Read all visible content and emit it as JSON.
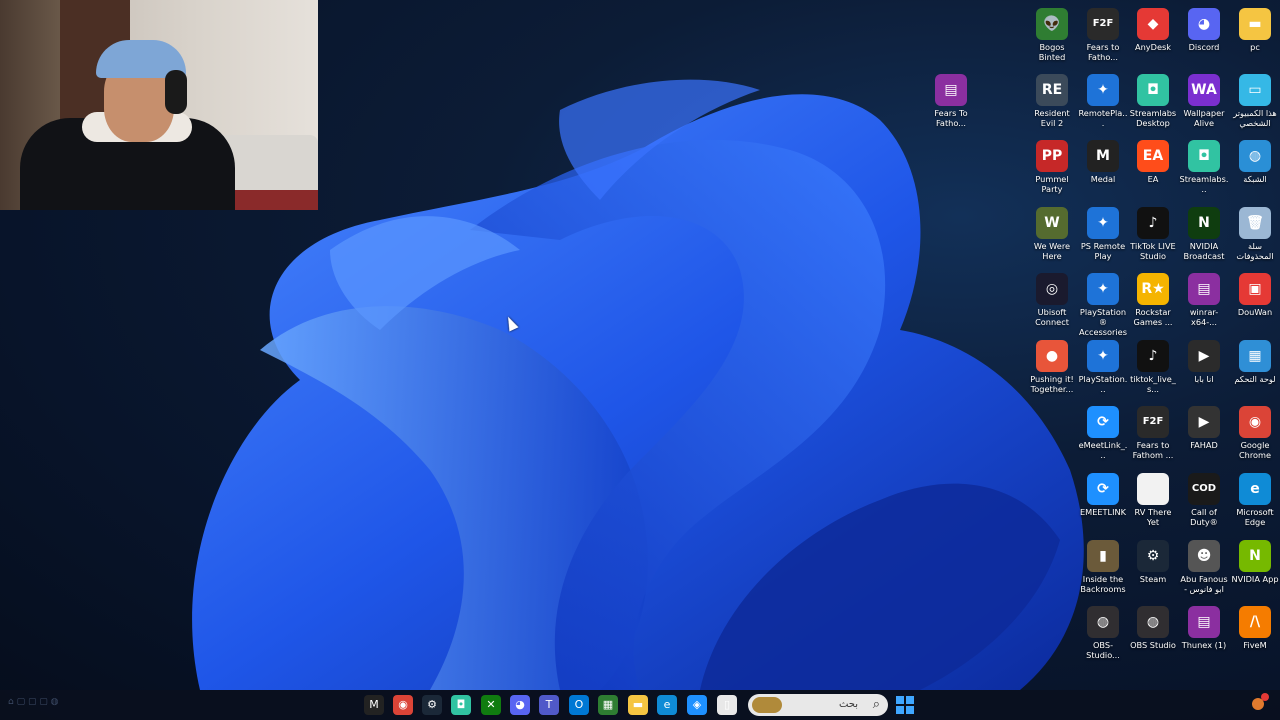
{
  "desktop": {
    "icons": [
      {
        "label": "Bogos Binted",
        "icon": "alien-icon",
        "color": "#2f7d32",
        "glyph": "👽"
      },
      {
        "label": "Fears to Fatho...",
        "icon": "f2f-icon",
        "color": "#2a2a2a",
        "glyph": "F2F"
      },
      {
        "label": "AnyDesk",
        "icon": "anydesk-icon",
        "color": "#e53935",
        "glyph": "◆"
      },
      {
        "label": "Discord",
        "icon": "discord-icon",
        "color": "#5865f2",
        "glyph": "◕"
      },
      {
        "label": "pc",
        "icon": "folder-icon",
        "color": "#f5c542",
        "glyph": "▬"
      },
      {
        "label": "Resident Evil 2",
        "icon": "resident-evil-icon",
        "color": "#3b4a5a",
        "glyph": "RE"
      },
      {
        "label": "RemotePla...",
        "icon": "remote-play-icon",
        "color": "#1e73d8",
        "glyph": "✦"
      },
      {
        "label": "Streamlabs Desktop",
        "icon": "streamlabs-icon",
        "color": "#31c3a2",
        "glyph": "◘"
      },
      {
        "label": "Wallpaper Alive",
        "icon": "wallpaper-alive-icon",
        "color": "#7b2fd0",
        "glyph": "WA"
      },
      {
        "label": "هذا الكمبيوتر الشخصي",
        "icon": "this-pc-icon",
        "color": "#35b8e6",
        "glyph": "▭"
      },
      {
        "label": "Pummel Party",
        "icon": "pummel-party-icon",
        "color": "#c62828",
        "glyph": "PP"
      },
      {
        "label": "Medal",
        "icon": "medal-icon",
        "color": "#222222",
        "glyph": "M"
      },
      {
        "label": "EA",
        "icon": "ea-icon",
        "color": "#ff4d1a",
        "glyph": "EA"
      },
      {
        "label": "Streamlabs...",
        "icon": "streamlabs-icon-2",
        "color": "#31c3a2",
        "glyph": "◘"
      },
      {
        "label": "الشبكة",
        "icon": "network-icon",
        "color": "#2a8fd6",
        "glyph": "◍"
      },
      {
        "label": "We Were Here",
        "icon": "we-were-here-icon",
        "color": "#556b2f",
        "glyph": "W"
      },
      {
        "label": "PS Remote Play",
        "icon": "ps-remote-play-icon",
        "color": "#1e73d8",
        "glyph": "✦"
      },
      {
        "label": "TikTok LIVE Studio",
        "icon": "tiktok-live-icon",
        "color": "#111",
        "glyph": "♪"
      },
      {
        "label": "NVIDIA Broadcast",
        "icon": "nvidia-broadcast-icon",
        "color": "#0f3d0f",
        "glyph": "N"
      },
      {
        "label": "سلة المحذوفات",
        "icon": "recycle-bin-icon",
        "color": "#9bb7d4",
        "glyph": "🗑"
      },
      {
        "label": "Ubisoft Connect",
        "icon": "ubisoft-icon",
        "color": "#1a1a2e",
        "glyph": "◎"
      },
      {
        "label": "PlayStation® Accessories",
        "icon": "ps-accessories-icon",
        "color": "#1e73d8",
        "glyph": "✦"
      },
      {
        "label": "Rockstar Games ...",
        "icon": "rockstar-icon",
        "color": "#f5b400",
        "glyph": "R★"
      },
      {
        "label": "winrar-x64-...",
        "icon": "winrar-icon",
        "color": "#8b2fa0",
        "glyph": "▤"
      },
      {
        "label": "DouWan",
        "icon": "douwan-icon",
        "color": "#e53935",
        "glyph": "▣"
      },
      {
        "label": "Pushing it! Together...",
        "icon": "pushing-it-icon",
        "color": "#e8553a",
        "glyph": "●"
      },
      {
        "label": "PlayStation...",
        "icon": "playstation-icon",
        "color": "#1e73d8",
        "glyph": "✦"
      },
      {
        "label": "tiktok_live_s...",
        "icon": "tiktok-live-setup-icon",
        "color": "#111",
        "glyph": "♪"
      },
      {
        "label": "انا بابا",
        "icon": "video-file-icon",
        "color": "#2b2b2b",
        "glyph": "▶"
      },
      {
        "label": "لوحة التحكم",
        "icon": "control-panel-icon",
        "color": "#2f8fd6",
        "glyph": "▦"
      },
      {
        "label": "eMeetLink_...",
        "icon": "emeetlink-setup-icon",
        "color": "#1e90ff",
        "glyph": "⟳"
      },
      {
        "label": "Fears to Fathom ...",
        "icon": "f2f-icon-2",
        "color": "#2a2a2a",
        "glyph": "F2F"
      },
      {
        "label": "FAHAD",
        "icon": "fahad-video-icon",
        "color": "#333",
        "glyph": "▶"
      },
      {
        "label": "Google Chrome",
        "icon": "chrome-icon",
        "color": "#db4437",
        "glyph": "◉"
      },
      {
        "label": "EMEETLINK",
        "icon": "emeetlink-icon",
        "color": "#1e90ff",
        "glyph": "⟳"
      },
      {
        "label": "RV There Yet",
        "icon": "document-icon",
        "color": "#f2f2f2",
        "glyph": ""
      },
      {
        "label": "Call of Duty®",
        "icon": "call-of-duty-icon",
        "color": "#1a1a1a",
        "glyph": "COD"
      },
      {
        "label": "Microsoft Edge",
        "icon": "edge-icon",
        "color": "#0f8bd6",
        "glyph": "e"
      },
      {
        "label": "Inside the Backrooms",
        "icon": "inside-backrooms-icon",
        "color": "#6b5a3a",
        "glyph": "▮"
      },
      {
        "label": "Steam",
        "icon": "steam-icon",
        "color": "#1b2838",
        "glyph": "⚙"
      },
      {
        "label": "Abu Fanous - ابو فانوس",
        "icon": "abu-fanous-icon",
        "color": "#555",
        "glyph": "☻"
      },
      {
        "label": "NVIDIA App",
        "icon": "nvidia-app-icon",
        "color": "#76b900",
        "glyph": "N"
      },
      {
        "label": "OBS-Studio...",
        "icon": "obs-setup-icon",
        "color": "#302e31",
        "glyph": "◍"
      },
      {
        "label": "OBS Studio",
        "icon": "obs-icon",
        "color": "#302e31",
        "glyph": "◍"
      },
      {
        "label": "Thunex (1)",
        "icon": "winrar-archive-icon",
        "color": "#8b2fa0",
        "glyph": "▤"
      },
      {
        "label": "FiveM",
        "icon": "fivem-icon",
        "color": "#f57c00",
        "glyph": "/\\"
      },
      {
        "label": "Fears To Fatho...",
        "icon": "winrar-fears-icon",
        "color": "#8b2fa0",
        "glyph": "▤"
      }
    ]
  },
  "taskbar": {
    "search_text": "بحث",
    "search_icon": "search-icon",
    "items": [
      {
        "name": "medal-taskbar-icon",
        "color": "#222",
        "glyph": "M"
      },
      {
        "name": "chrome-taskbar-icon",
        "color": "#db4437",
        "glyph": "◉"
      },
      {
        "name": "steam-taskbar-icon",
        "color": "#1b2838",
        "glyph": "⚙"
      },
      {
        "name": "streamlabs-taskbar-icon",
        "color": "#31c3a2",
        "glyph": "◘"
      },
      {
        "name": "xbox-taskbar-icon",
        "color": "#107c10",
        "glyph": "✕"
      },
      {
        "name": "discord-taskbar-icon",
        "color": "#5865f2",
        "glyph": "◕"
      },
      {
        "name": "teams-taskbar-icon",
        "color": "#5059c9",
        "glyph": "T"
      },
      {
        "name": "outlook-taskbar-icon",
        "color": "#0078d4",
        "glyph": "O"
      },
      {
        "name": "calculator-taskbar-icon",
        "color": "#2e7d32",
        "glyph": "▦"
      },
      {
        "name": "file-explorer-taskbar-icon",
        "color": "#f5c542",
        "glyph": "▬"
      },
      {
        "name": "edge-taskbar-icon",
        "color": "#0f8bd6",
        "glyph": "e"
      },
      {
        "name": "photos-taskbar-icon",
        "color": "#1e90ff",
        "glyph": "◈"
      },
      {
        "name": "notepad-taskbar-icon",
        "color": "#e8e8e8",
        "glyph": "▯"
      }
    ]
  },
  "colors": {
    "accent": "#2a6bff",
    "taskbar": "#0a101e"
  }
}
